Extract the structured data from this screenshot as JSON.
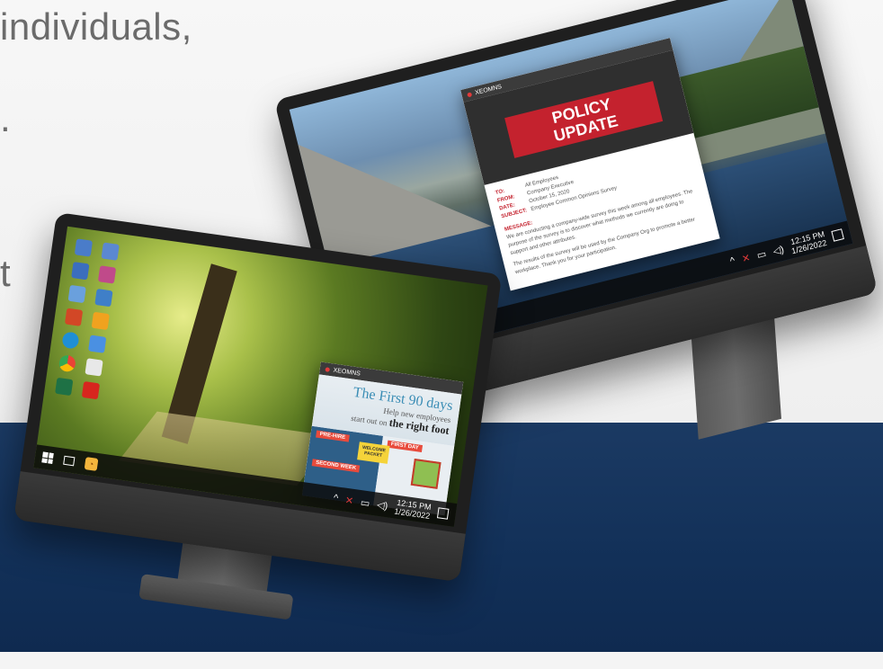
{
  "headline": {
    "line1": "individuals,",
    "line2": ".",
    "line3": "t"
  },
  "right_monitor": {
    "popup": {
      "window_title": "XEOMNS",
      "banner_line1": "POLICY",
      "banner_line2": "UPDATE",
      "to_label": "TO:",
      "to_value": "All Employees",
      "from_label": "FROM:",
      "from_value": "Company Executive",
      "date_label": "DATE:",
      "date_value": "October 15, 2020",
      "subject_label": "SUBJECT:",
      "subject_value": "Employee Common Opinions Survey",
      "message_label": "MESSAGE:",
      "message_text": "We are conducting a company-wide survey this week among all employees. The purpose of the survey is to discover what methods we currently are doing to support and other attributes.",
      "message_text2": "The results of the survey will be used by the Company Org to promote a better workplace. Thank you for your participation."
    },
    "taskbar": {
      "time": "12:15 PM",
      "date": "1/26/2022"
    }
  },
  "left_monitor": {
    "popup": {
      "window_title": "XEOMNS",
      "title": "The First 90 days",
      "subtitle_line1": "Help new employees",
      "subtitle_line2_prefix": "start out on",
      "subtitle_line2_emph": "the right foot",
      "pre_hire": "PRE-HIRE",
      "first_day": "FIRST DAY",
      "welcome_note": "WELCOME PACKET",
      "second_week": "SECOND WEEK"
    },
    "taskbar": {
      "time": "12:15 PM",
      "date": "1/26/2022"
    }
  },
  "colors": {
    "navy_band": "#123058",
    "policy_red": "#c4222e",
    "first90_blue": "#3a8db5"
  }
}
